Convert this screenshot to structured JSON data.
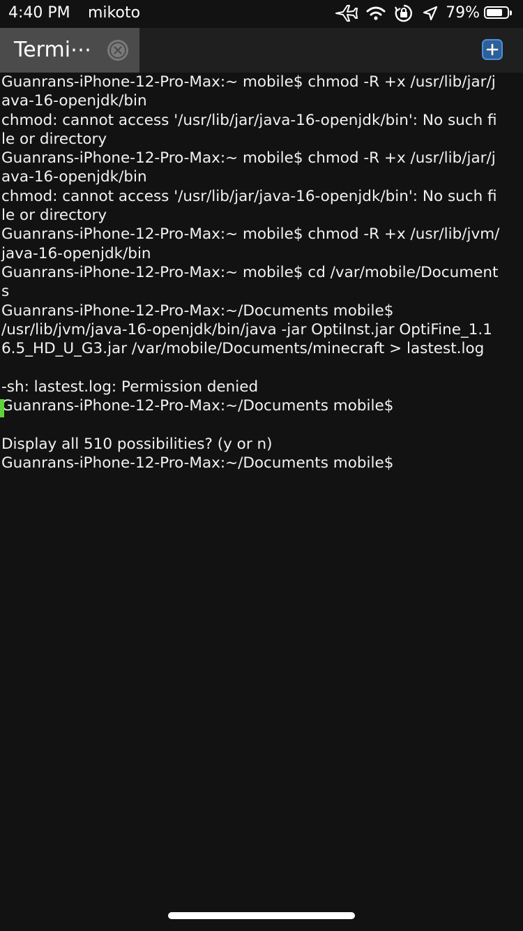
{
  "status_bar": {
    "time": "4:40 PM",
    "carrier": "mikoto",
    "battery_percent": "79%",
    "battery_level": 0.79,
    "icons": [
      "airplane-icon",
      "wifi-icon",
      "orientation-lock-icon",
      "location-icon",
      "battery-icon"
    ]
  },
  "tab_bar": {
    "active_tab_label": "Termi⋯",
    "close_icon": "close-icon",
    "new_tab_icon": "plus-icon"
  },
  "terminal": {
    "lines": [
      "Guanrans-iPhone-12-Pro-Max:~ mobile$ chmod -R +x /usr/lib/jar/j",
      "ava-16-openjdk/bin",
      "chmod: cannot access '/usr/lib/jar/java-16-openjdk/bin': No such fi",
      "le or directory",
      "Guanrans-iPhone-12-Pro-Max:~ mobile$ chmod -R +x /usr/lib/jar/j",
      "ava-16-openjdk/bin",
      "chmod: cannot access '/usr/lib/jar/java-16-openjdk/bin': No such fi",
      "le or directory",
      "Guanrans-iPhone-12-Pro-Max:~ mobile$ chmod -R +x /usr/lib/jvm/",
      "java-16-openjdk/bin",
      "Guanrans-iPhone-12-Pro-Max:~ mobile$ cd /var/mobile/Document",
      "s",
      "Guanrans-iPhone-12-Pro-Max:~/Documents mobile$",
      "/usr/lib/jvm/java-16-openjdk/bin/java -jar OptiInst.jar OptiFine_1.1",
      "6.5_HD_U_G3.jar /var/mobile/Documents/minecraft > lastest.log",
      "",
      "-sh: lastest.log: Permission denied",
      "Guanrans-iPhone-12-Pro-Max:~/Documents mobile$",
      "",
      "Display all 510 possibilities? (y or n)",
      "Guanrans-iPhone-12-Pro-Max:~/Documents mobile$"
    ],
    "cursor_color": "#5fd33a"
  },
  "colors": {
    "background": "#121212",
    "tab_active": "#4b4b4b",
    "tab_bar": "#1f1f1f",
    "accent_blue": "#4a90e2",
    "text": "#f2f2f2"
  }
}
